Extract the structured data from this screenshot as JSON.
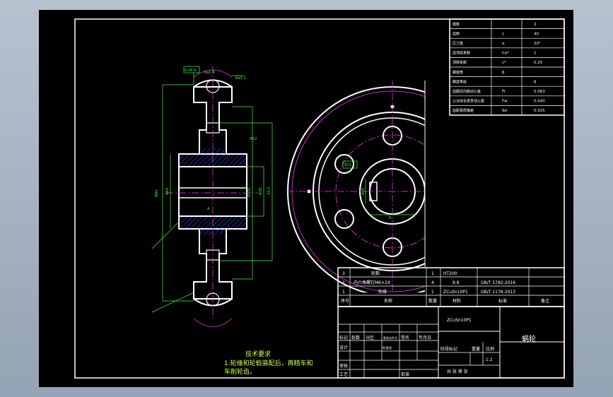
{
  "param_table": {
    "rows": [
      [
        "模数",
        "",
        "2"
      ],
      [
        "齿数",
        "z",
        "40"
      ],
      [
        "压力角",
        "α",
        "20°"
      ],
      [
        "齿顶高系数",
        "ha*",
        "1"
      ],
      [
        "顶隙系数",
        "c*",
        "0.25"
      ],
      [
        "螺旋角",
        "β",
        ""
      ],
      [
        "精度等级",
        "",
        "8"
      ],
      [
        "齿圈径向跳动公差",
        "Fr",
        "0.063"
      ],
      [
        "公法线长度变动公差",
        "Fw",
        "0.040"
      ],
      [
        "齿距极限偏差",
        "fpt",
        "0.025"
      ]
    ]
  },
  "parts_list": {
    "rows": [
      [
        "3",
        "轮毂",
        "1",
        "HT200",
        ""
      ],
      [
        "2",
        "内六角螺钉M6×24",
        "4",
        "8.8",
        "GB/T 5782-2016"
      ],
      [
        "1",
        "轮缘",
        "1",
        "ZCuSn10P1",
        "GB/T 1176-2013"
      ]
    ],
    "header": [
      "序号",
      "名称",
      "数量",
      "材料",
      "标准",
      "备注"
    ]
  },
  "title_block": {
    "material": "ZCuSn10P1",
    "part_name": "蜗轮",
    "scale": "1:2",
    "labels": {
      "mark": "标记",
      "count": "处数",
      "zone": "分区",
      "doc_no": "更改文件号",
      "sign": "签名",
      "date": "年月日",
      "designer": "设计",
      "standardize": "标准化",
      "stage_mark": "阶段标记",
      "weight": "重量",
      "scale_label": "比例",
      "review": "审核",
      "process": "工艺",
      "approve": "批准",
      "sheet": "共 张 第 张"
    }
  },
  "notes": {
    "title": "技术要求",
    "line1": "1.轮缘和轮毂装配后，再精车和",
    "line2": "车削轮齿。"
  },
  "dims": {
    "tol_frame": "0.04 A",
    "ra_top": "Ra1.6",
    "ra_right": "Ra3.2",
    "outer_d": "Φ84",
    "hub_d": "Φ60",
    "bore_d": "Φ30",
    "web_d": "Φ100",
    "hole_d": "Φ12",
    "keyway": "8",
    "key_depth": "33.3",
    "bore_lbl": "Φ30",
    "a_datum": "A"
  },
  "colors": {
    "frame": "#ffffff",
    "dimension": "#35ff35",
    "centerline": "#ff33ff",
    "hatch": "#3344ff",
    "note": "#c8ff3c",
    "background": "#000000"
  }
}
